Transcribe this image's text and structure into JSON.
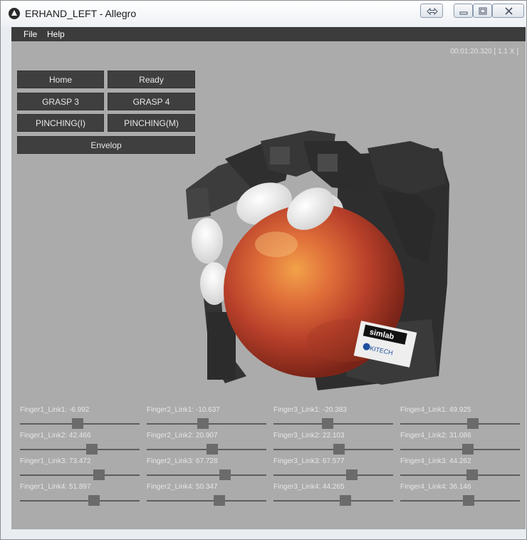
{
  "window": {
    "title": "ERHAND_LEFT - Allegro"
  },
  "menu": {
    "file": "File",
    "help": "Help"
  },
  "timer": "00:01:20.320  [ 1.1 X ]",
  "pose_buttons": {
    "home": "Home",
    "ready": "Ready",
    "grasp3": "GRASP 3",
    "grasp4": "GRASP 4",
    "pinching_i": "PINCHING(I)",
    "pinching_m": "PINCHING(M)",
    "envelop": "Envelop"
  },
  "logo_text": [
    "simlab",
    "KITECH"
  ],
  "sliders": [
    {
      "label": "Finger1_Link1:  -6.992",
      "fraction": 0.48
    },
    {
      "label": "Finger2_Link1:  -10.637",
      "fraction": 0.47
    },
    {
      "label": "Finger3_Link1:  -20.383",
      "fraction": 0.45
    },
    {
      "label": "Finger4_Link1:  49.925",
      "fraction": 0.62
    },
    {
      "label": "Finger1_Link2:  42.466",
      "fraction": 0.61
    },
    {
      "label": "Finger2_Link2:  20.907",
      "fraction": 0.55
    },
    {
      "label": "Finger3_Link2:  22.103",
      "fraction": 0.55
    },
    {
      "label": "Finger4_Link2:  31.086",
      "fraction": 0.57
    },
    {
      "label": "Finger1_Link3:  73.472",
      "fraction": 0.68
    },
    {
      "label": "Finger2_Link3:  67.728",
      "fraction": 0.67
    },
    {
      "label": "Finger3_Link3:  67.577",
      "fraction": 0.67
    },
    {
      "label": "Finger4_Link3:  44.262",
      "fraction": 0.61
    },
    {
      "label": "Finger1_Link4:  51.897",
      "fraction": 0.63
    },
    {
      "label": "Finger2_Link4:  50.347",
      "fraction": 0.62
    },
    {
      "label": "Finger3_Link4:  44.265",
      "fraction": 0.61
    },
    {
      "label": "Finger4_Link4:  36.146",
      "fraction": 0.58
    }
  ],
  "colors": {
    "viewport": "#ababab",
    "button": "#3f3f3f",
    "menubar": "#3c3c3c"
  }
}
